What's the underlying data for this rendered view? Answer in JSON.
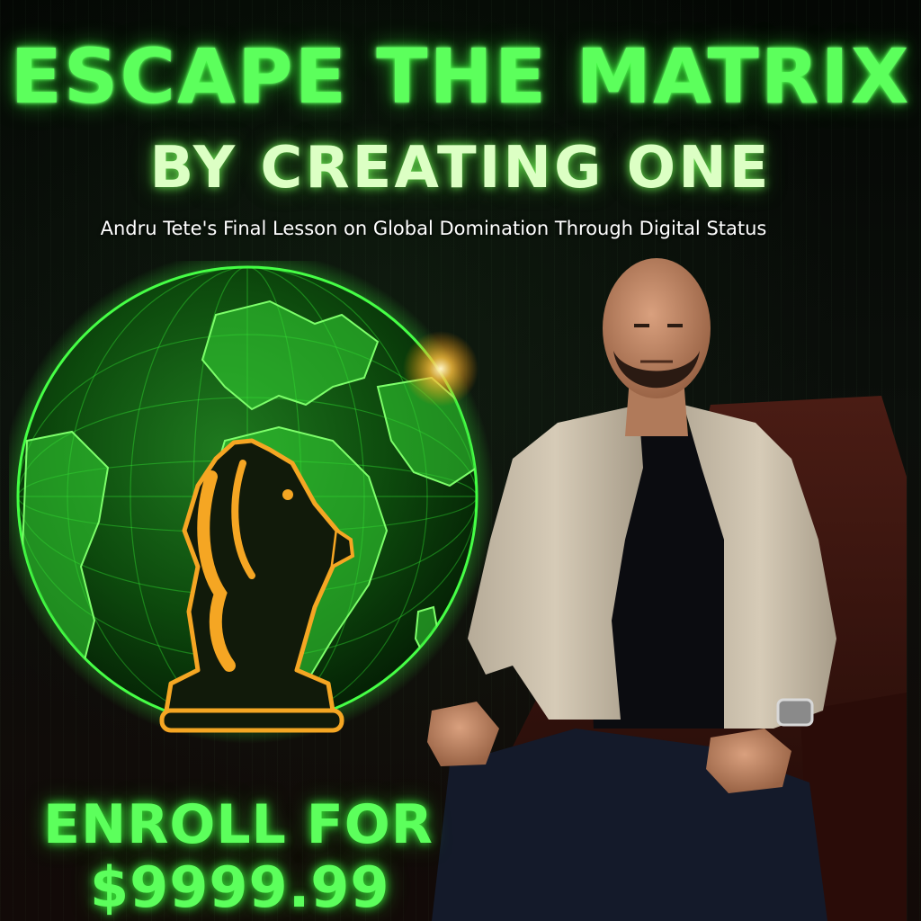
{
  "headline": {
    "line1": "ESCAPE THE MATRIX",
    "line2": "BY CREATING ONE"
  },
  "subtitle": "Andru Tete's Final Lesson on Global Domination Through Digital Status",
  "cta": {
    "line1": "ENROLL FOR",
    "price": "$9999.99"
  },
  "artwork": {
    "globe": "glowing-green-circuit-globe",
    "emblem": "chess-knight-icon",
    "person": "bald-man-beige-blazer-seated-in-leather-chair"
  },
  "colors": {
    "neon_green": "#5cff5c",
    "pale_green": "#dcffc4",
    "knight_gold": "#f5a623",
    "background": "#050805"
  }
}
